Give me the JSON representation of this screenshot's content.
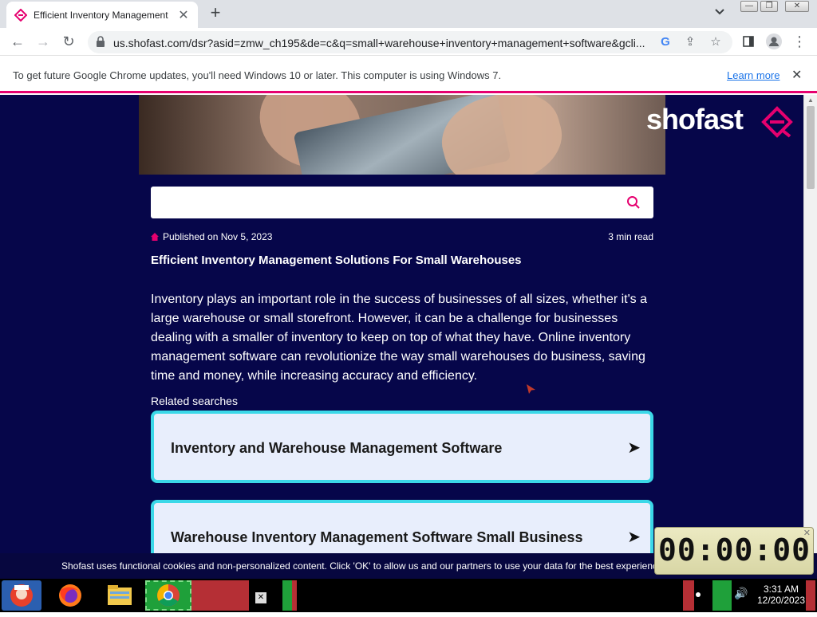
{
  "browser": {
    "tab_title": "Efficient Inventory Management",
    "tab_close": "✕",
    "new_tab": "+",
    "url": "us.shofast.com/dsr?asid=zmw_ch195&de=c&q=small+warehouse+inventory+management+software&gcli..."
  },
  "infobar": {
    "message": "To get future Google Chrome updates, you'll need Windows 10 or later. This computer is using Windows 7.",
    "link": "Learn more",
    "close": "✕"
  },
  "site": {
    "logo": "shofast",
    "published": "Published on Nov 5, 2023",
    "read_time": "3 min read",
    "article_title": "Efficient Inventory Management Solutions For Small Warehouses",
    "article_body": "Inventory plays an important role in the success of businesses of all sizes, whether it's a large warehouse or small storefront. However, it can be a challenge for businesses dealing with a smaller of inventory to keep on top of what they have. Online inventory management software can revolutionize the way small warehouses do business, saving time and money, while increasing accuracy and efficiency.",
    "related_label": "Related searches",
    "related": [
      {
        "label": "Inventory and Warehouse Management Software",
        "arrow": "➤"
      },
      {
        "label": "Warehouse Inventory Management Software Small Business",
        "arrow": "➤"
      }
    ]
  },
  "cookie_bar": {
    "text": "Shofast uses functional cookies and non-personalized content. Click 'OK' to allow us and our partners to use your data for the best experience"
  },
  "timer": {
    "value": "00:00:00"
  },
  "taskbar": {
    "time": "3:31 AM",
    "date": "12/20/2023"
  },
  "colors": {
    "page_bg": "#06064a",
    "accent": "#e6006f",
    "card_border": "#3bd8e8",
    "card_bg": "#e8eefc"
  }
}
